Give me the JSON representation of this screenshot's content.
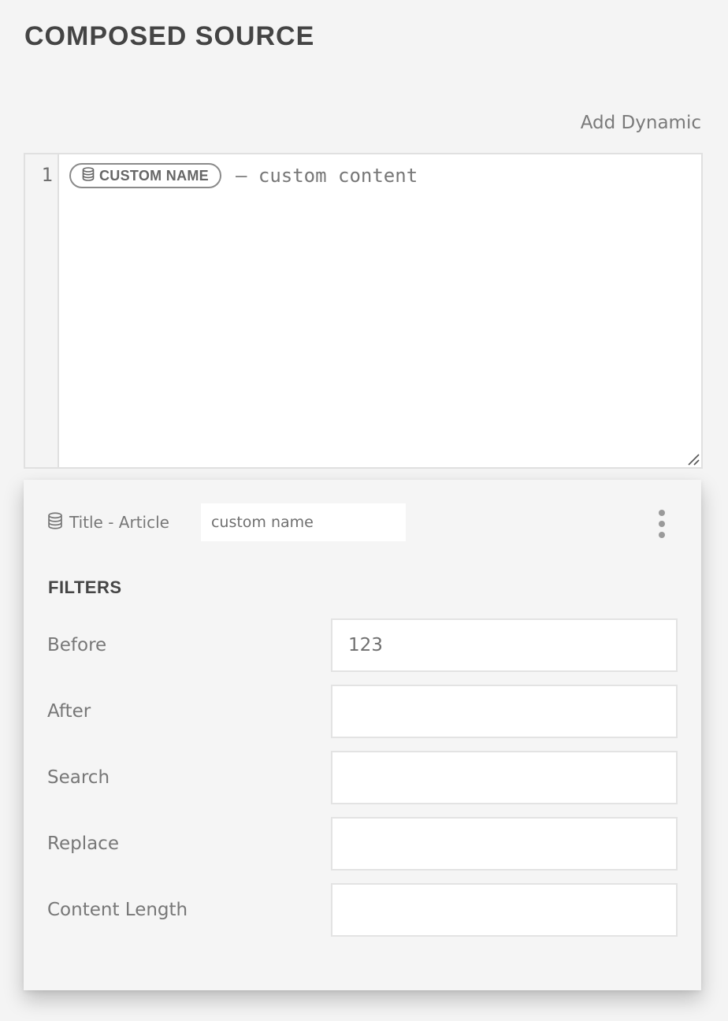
{
  "header": {
    "title": "COMPOSED SOURCE",
    "add_dynamic_label": "Add Dynamic"
  },
  "editor": {
    "lines": [
      {
        "number": "1",
        "chip": {
          "icon": "database-icon",
          "label": "CUSTOM NAME"
        },
        "text": "– custom content"
      }
    ]
  },
  "dynamic_panel": {
    "source": {
      "icon": "database-icon",
      "label": "Title - Article"
    },
    "name_input": {
      "value": "custom name",
      "placeholder": ""
    },
    "menu_icon": "kebab-menu-icon",
    "filters": {
      "title": "FILTERS",
      "rows": [
        {
          "label": "Before",
          "value": "123"
        },
        {
          "label": "After",
          "value": ""
        },
        {
          "label": "Search",
          "value": ""
        },
        {
          "label": "Replace",
          "value": ""
        },
        {
          "label": "Content Length",
          "value": ""
        }
      ]
    }
  },
  "colors": {
    "background": "#f4f4f4",
    "title_text": "#444444",
    "body_text": "#777777",
    "border": "#e0e0e0",
    "input_bg": "#ffffff"
  }
}
